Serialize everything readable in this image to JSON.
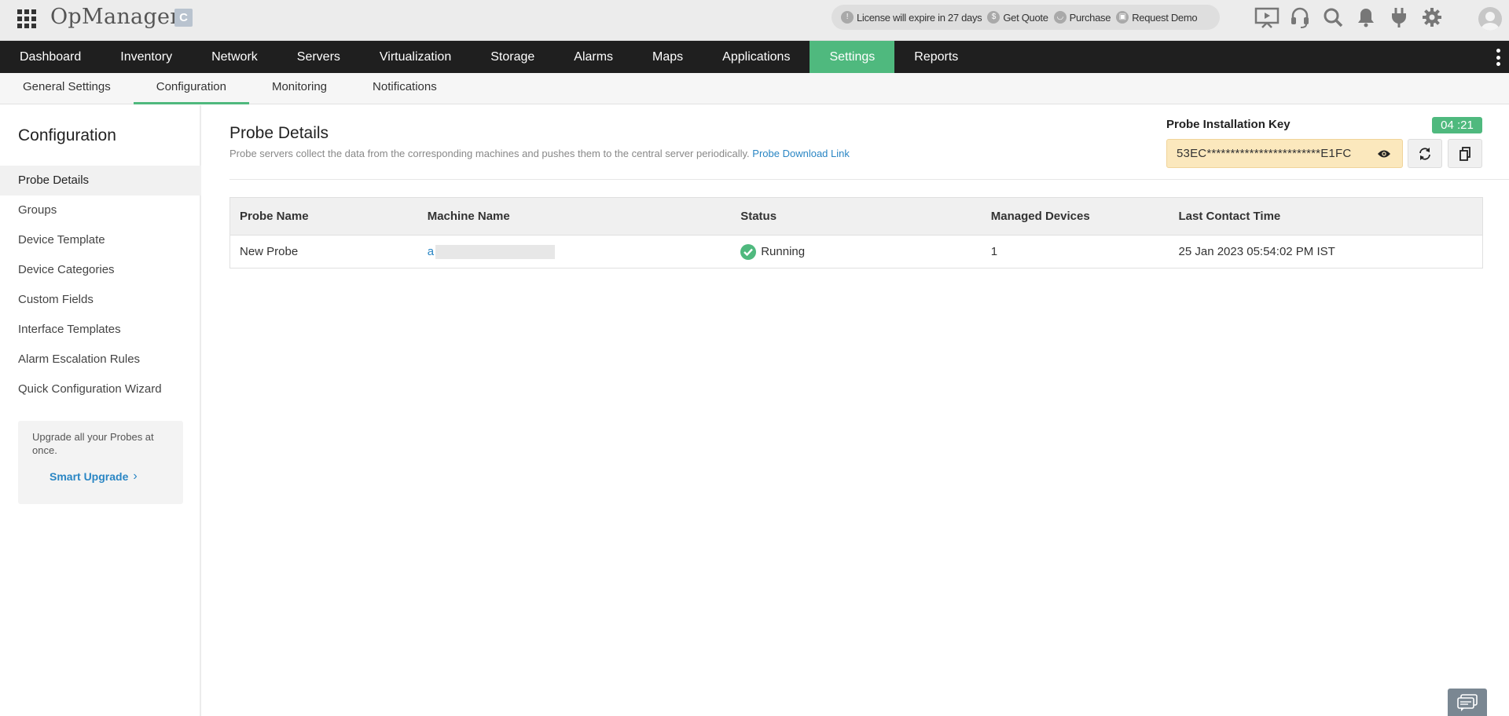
{
  "header": {
    "brand": "OpManager",
    "edition_badge": "C",
    "license": {
      "expiry": "License will expire in 27 days",
      "get_quote": "Get Quote",
      "purchase": "Purchase",
      "request_demo": "Request Demo"
    },
    "icons": [
      "presentation-icon",
      "headset-icon",
      "search-icon",
      "bell-icon",
      "plug-icon",
      "gear-icon",
      "user-avatar-icon"
    ]
  },
  "nav": {
    "items": [
      {
        "label": "Dashboard"
      },
      {
        "label": "Inventory"
      },
      {
        "label": "Network"
      },
      {
        "label": "Servers"
      },
      {
        "label": "Virtualization"
      },
      {
        "label": "Storage"
      },
      {
        "label": "Alarms"
      },
      {
        "label": "Maps"
      },
      {
        "label": "Applications"
      },
      {
        "label": "Settings",
        "active": true
      },
      {
        "label": "Reports"
      }
    ]
  },
  "subnav": {
    "items": [
      {
        "label": "General Settings"
      },
      {
        "label": "Configuration",
        "active": true
      },
      {
        "label": "Monitoring"
      },
      {
        "label": "Notifications"
      }
    ]
  },
  "sidebar": {
    "title": "Configuration",
    "items": [
      {
        "label": "Probe Details",
        "active": true
      },
      {
        "label": "Groups"
      },
      {
        "label": "Device Template"
      },
      {
        "label": "Device Categories"
      },
      {
        "label": "Custom Fields"
      },
      {
        "label": "Interface Templates"
      },
      {
        "label": "Alarm Escalation Rules"
      },
      {
        "label": "Quick Configuration Wizard"
      }
    ],
    "upgrade": {
      "text": "Upgrade all your Probes at once.",
      "link": "Smart Upgrade"
    }
  },
  "main": {
    "title": "Probe Details",
    "description": "Probe servers collect the data from the corresponding machines and pushes them to the central server periodically.",
    "download_link": "Probe Download Link",
    "key": {
      "label": "Probe Installation Key",
      "timer": "04 :21",
      "value": "53EC************************E1FC"
    },
    "table": {
      "columns": [
        "Probe Name",
        "Machine Name",
        "Status",
        "Managed Devices",
        "Last Contact Time"
      ],
      "rows": [
        {
          "probe_name": "New Probe",
          "machine_name": "a",
          "status": "Running",
          "managed_devices": "1",
          "last_contact": "25 Jan 2023 05:54:02 PM IST"
        }
      ]
    }
  },
  "colors": {
    "accent": "#4fb97e",
    "link": "#2a86c4",
    "nav_bg": "#1f1f1f",
    "key_bg": "#fbe8bd"
  }
}
